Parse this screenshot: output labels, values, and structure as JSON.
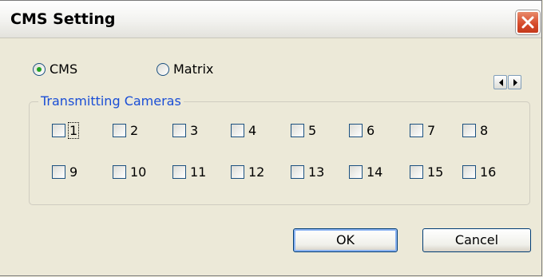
{
  "window": {
    "title": "CMS Setting"
  },
  "mode": {
    "options": [
      {
        "label": "CMS",
        "selected": true
      },
      {
        "label": "Matrix",
        "selected": false
      }
    ]
  },
  "group": {
    "label": "Transmitting Cameras"
  },
  "cameras": [
    "1",
    "2",
    "3",
    "4",
    "5",
    "6",
    "7",
    "8",
    "9",
    "10",
    "11",
    "12",
    "13",
    "14",
    "15",
    "16"
  ],
  "buttons": {
    "ok": "OK",
    "cancel": "Cancel"
  },
  "colors": {
    "group_label": "#1a4ed6",
    "close_button": "#d6492a",
    "radio_selected": "#21a121"
  },
  "icons": {
    "close": "close-icon",
    "scroll_left": "chevron-left-icon",
    "scroll_right": "chevron-right-icon"
  }
}
